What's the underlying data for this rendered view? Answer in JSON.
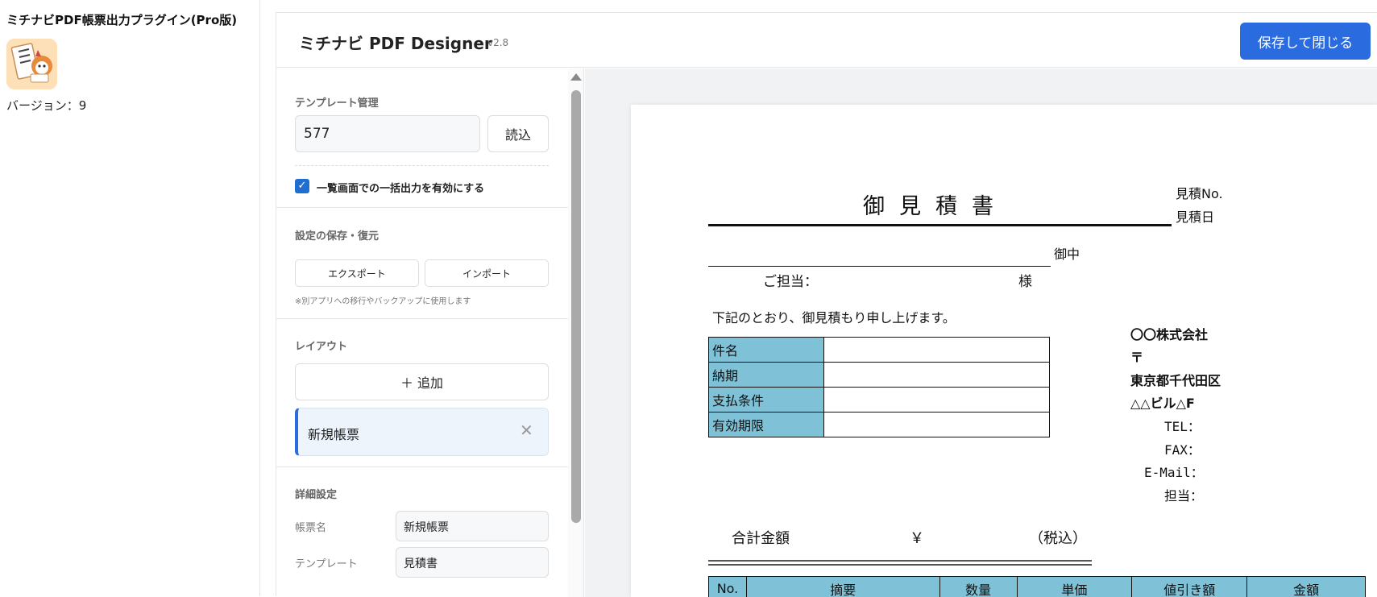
{
  "plugin": {
    "title": "ミチナビPDF帳票出力プラグイン(Pro版)",
    "version_text": "バージョン：9",
    "icon": "plugin-icon"
  },
  "header": {
    "app_title": "ミチナビ PDF Designer",
    "app_version": "v2.8",
    "save_label": "保存して閉じる"
  },
  "sidebar": {
    "template_section": "テンプレート管理",
    "template_value": "577",
    "load_label": "読込",
    "bulk_checkbox_checked": true,
    "bulk_checkbox_label": "一覧画面での一括出力を有効にする",
    "backup_section": "設定の保存・復元",
    "export_label": "エクスポート",
    "import_label": "インポート",
    "backup_note": "※別アプリへの移行やバックアップに使用します",
    "layout_section": "レイアウト",
    "add_label": "＋ 追加",
    "layouts": [
      {
        "label": "新規帳票"
      }
    ],
    "detail_section": "詳細設定",
    "form_name_label": "帳票名",
    "form_name_value": "新規帳票",
    "template_label": "テンプレート",
    "template_select_value": "見積書"
  },
  "document": {
    "title": "御見積書",
    "estimate_no_label": "見積No.",
    "estimate_date_label": "見積日",
    "onchu": "御中",
    "tanto_label": "ご担当：",
    "sama": "様",
    "intro": "下記のとおり、御見積もり申し上げます。",
    "info_rows": [
      {
        "label": "件名"
      },
      {
        "label": "納期"
      },
      {
        "label": "支払条件"
      },
      {
        "label": "有効期限"
      }
    ],
    "company": {
      "name": "〇〇株式会社",
      "postal": "〒",
      "address1": "東京都千代田区",
      "address2": "△△ビル△F",
      "tel": "TEL：",
      "fax": "FAX：",
      "email": "E-Mail：",
      "person": "担当："
    },
    "total_label": "合計金額",
    "yen": "￥",
    "tax_label": "（税込）",
    "item_headers": [
      "No.",
      "摘要",
      "数量",
      "単価",
      "値引き額",
      "金額"
    ]
  },
  "colors": {
    "accent": "#2b6be0",
    "table_header": "#7fc2d8"
  }
}
